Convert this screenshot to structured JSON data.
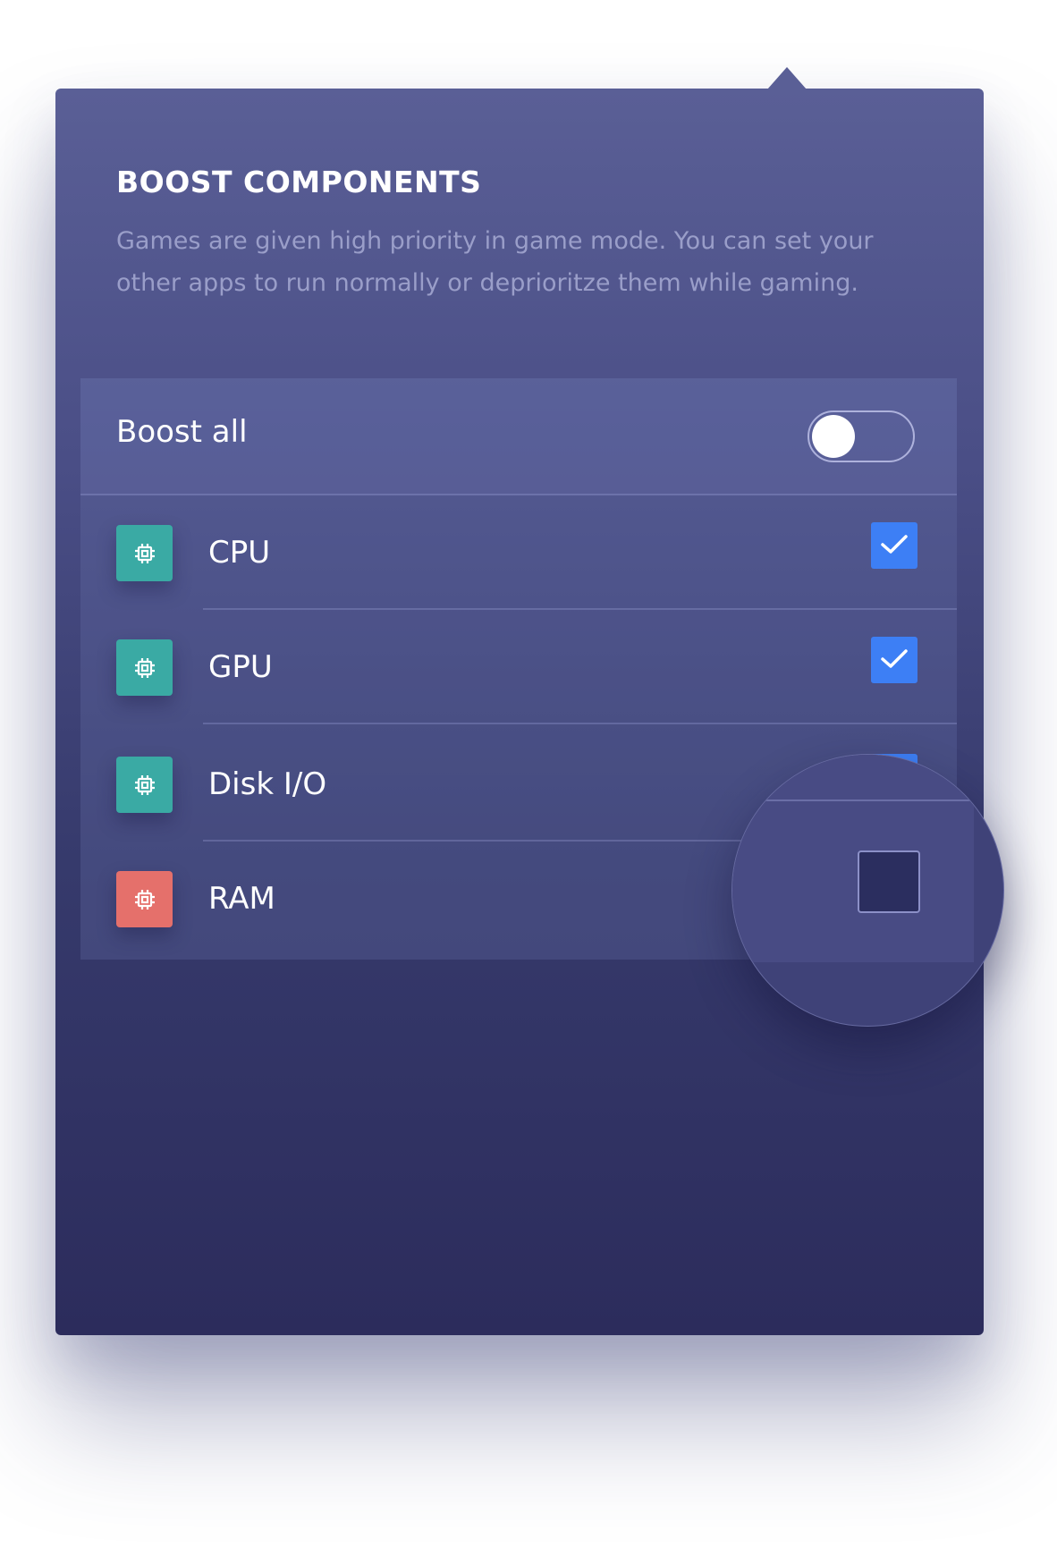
{
  "popover": {
    "title": "BOOST COMPONENTS",
    "description": "Games are given high priority in game mode. You can set your other apps to run normally or deprioritze them while gaming."
  },
  "boost_all": {
    "label": "Boost all",
    "enabled": false
  },
  "components": [
    {
      "label": "CPU",
      "checked": true,
      "icon": "chip-icon",
      "icon_color": "#3aaaa4"
    },
    {
      "label": "GPU",
      "checked": true,
      "icon": "chip-icon",
      "icon_color": "#3aaaa4"
    },
    {
      "label": "Disk I/O",
      "checked": true,
      "icon": "chip-icon",
      "icon_color": "#3aaaa4"
    },
    {
      "label": "RAM",
      "checked": false,
      "icon": "chip-icon",
      "icon_color": "#e5706b"
    }
  ],
  "colors": {
    "accent": "#3d7ff5",
    "teal": "#3aaaa4",
    "coral": "#e5706b",
    "background_top": "#5a5f96",
    "background_bottom": "#2c2c5c"
  }
}
